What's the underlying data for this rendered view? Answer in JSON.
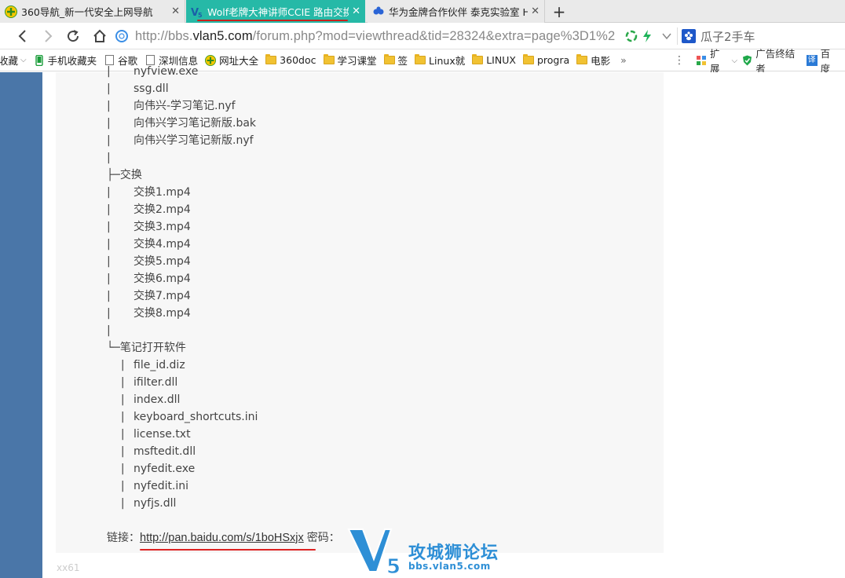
{
  "tabs": [
    {
      "title": "360导航_新一代安全上网导航",
      "icon": "360-logo-icon"
    },
    {
      "title": "Wolf老牌大神讲师CCIE 路由交换",
      "icon": "v5-logo-icon"
    },
    {
      "title": "华为金牌合作伙伴 泰克实验室 H",
      "icon": "baidu-paw-icon"
    }
  ],
  "new_tab_label": "+",
  "address": {
    "url_prefix": "http://bbs.",
    "url_domain": "vlan5.com",
    "url_suffix": "/forum.php?mod=viewthread&tid=28324&extra=page%3D1%2"
  },
  "search": {
    "value": "瓜子2手车"
  },
  "bookmarks": [
    {
      "label": "收藏",
      "icon": "star-icon"
    },
    {
      "label": "手机收藏夹",
      "icon": "phone-icon"
    },
    {
      "label": "谷歌",
      "icon": "page-icon"
    },
    {
      "label": "深圳信息",
      "icon": "page-icon"
    },
    {
      "label": "网址大全",
      "icon": "360-logo-icon"
    },
    {
      "label": "360doc",
      "icon": "folder-icon"
    },
    {
      "label": "学习课堂",
      "icon": "folder-icon"
    },
    {
      "label": "签",
      "icon": "folder-icon"
    },
    {
      "label": "Linux就",
      "icon": "folder-icon"
    },
    {
      "label": "LINUX",
      "icon": "folder-icon"
    },
    {
      "label": "progra",
      "icon": "folder-icon"
    },
    {
      "label": "电影",
      "icon": "folder-icon"
    }
  ],
  "bookmark_more": "»",
  "toolbar_right": {
    "extensions_label": "扩展",
    "adblock_label": "广告终结者",
    "translate_label": "百度"
  },
  "tree": {
    "top_cut": "nyfview.exe",
    "group1_files": [
      "ssg.dll",
      "向伟兴-学习笔记.nyf",
      "向伟兴学习笔记新版.bak",
      "向伟兴学习笔记新版.nyf"
    ],
    "group2_name": "交换",
    "group2_files": [
      "交换1.mp4",
      "交换2.mp4",
      "交换3.mp4",
      "交换4.mp4",
      "交换5.mp4",
      "交换6.mp4",
      "交换7.mp4",
      "交换8.mp4"
    ],
    "group3_name": "笔记打开软件",
    "group3_files": [
      "file_id.diz",
      "ifilter.dll",
      "index.dll",
      "keyboard_shortcuts.ini",
      "license.txt",
      "msftedit.dll",
      "nyfedit.exe",
      "nyfedit.ini",
      "nyfjs.dll"
    ]
  },
  "link": {
    "label": "链接：",
    "url": "http://pan.baidu.com/s/1boHSxjx",
    "password_label": "密码："
  },
  "signature": "xx61",
  "watermark": {
    "cn": "攻城狮论坛",
    "en": "bbs.vlan5.com"
  },
  "colors": {
    "active_tab": "#26b9a7",
    "left_strip": "#4a76a8",
    "watermark": "#2e8fd6",
    "annotation_red": "#d22222"
  }
}
